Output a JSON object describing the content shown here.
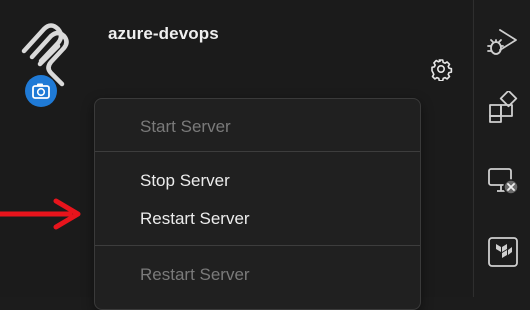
{
  "server": {
    "name": "azure-devops"
  },
  "menu": {
    "items": [
      {
        "label": "Start Server",
        "enabled": false
      },
      {
        "label": "Stop Server",
        "enabled": true
      },
      {
        "label": "Restart Server",
        "enabled": true
      },
      {
        "label": "Restart Server",
        "enabled": false
      }
    ]
  },
  "icons": {
    "logo": "server-logo-icon",
    "badge": "camera-badge-icon",
    "gear": "gear-icon",
    "annotation": "red-arrow-icon",
    "activity": [
      "run-debug-icon",
      "extensions-icon",
      "remote-explorer-icon",
      "terraform-icon"
    ]
  },
  "colors": {
    "badge": "#1f7ad6",
    "arrow": "#e8141c",
    "background": "#1b1b1b",
    "menu_background": "#202020"
  }
}
